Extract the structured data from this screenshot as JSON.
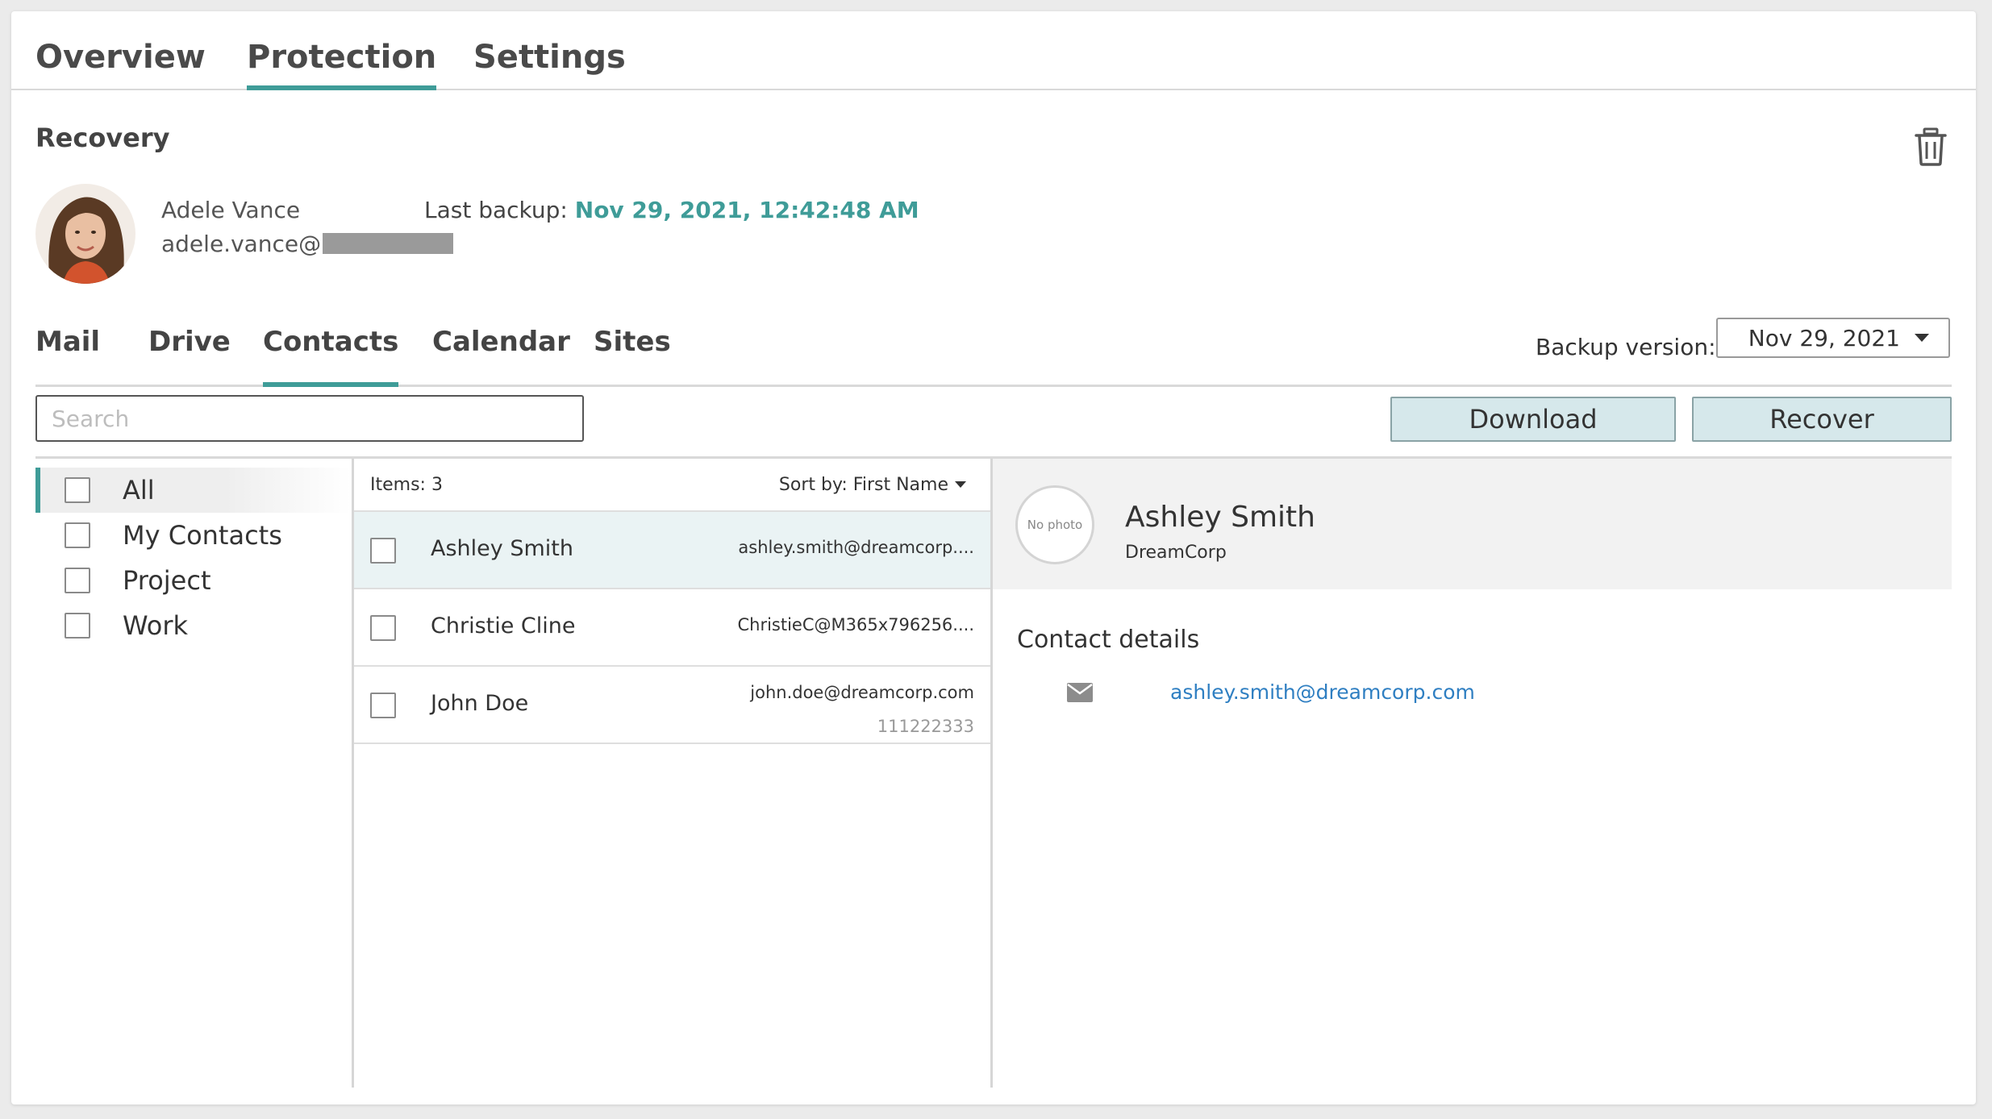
{
  "top_tabs": [
    {
      "label": "Overview"
    },
    {
      "label": "Protection"
    },
    {
      "label": "Settings"
    }
  ],
  "recovery": {
    "title": "Recovery",
    "user": {
      "name": "Adele Vance",
      "email_prefix": "adele.vance@"
    },
    "last_backup_label": "Last backup:",
    "last_backup_value": "Nov 29, 2021, 12:42:48 AM"
  },
  "sub_tabs": [
    {
      "label": "Mail"
    },
    {
      "label": "Drive"
    },
    {
      "label": "Contacts"
    },
    {
      "label": "Calendar"
    },
    {
      "label": "Sites"
    }
  ],
  "backup_version": {
    "label": "Backup version:",
    "selected": "Nov 29, 2021"
  },
  "search": {
    "placeholder": "Search",
    "value": ""
  },
  "actions": {
    "download": "Download",
    "recover": "Recover"
  },
  "folders": [
    {
      "label": "All",
      "active": true
    },
    {
      "label": "My Contacts"
    },
    {
      "label": "Project"
    },
    {
      "label": "Work"
    }
  ],
  "list": {
    "items_label": "Items: 3",
    "sort_label": "Sort by: First Name",
    "rows": [
      {
        "name": "Ashley Smith",
        "email": "ashley.smith@dreamcorp....",
        "phone": ""
      },
      {
        "name": "Christie Cline",
        "email": "ChristieC@M365x796256....",
        "phone": ""
      },
      {
        "name": "John Doe",
        "email": "john.doe@dreamcorp.com",
        "phone": "111222333"
      }
    ]
  },
  "detail": {
    "no_photo": "No photo",
    "name": "Ashley Smith",
    "company": "DreamCorp",
    "section_title": "Contact details",
    "email": "ashley.smith@dreamcorp.com"
  },
  "colors": {
    "accent": "#3f9c98",
    "link": "#2f7fc2",
    "button_bg": "#d6e8eb",
    "selected_row": "#eaf3f4"
  },
  "icons": [
    "trash-icon",
    "mail-icon",
    "chevron-down-icon"
  ]
}
